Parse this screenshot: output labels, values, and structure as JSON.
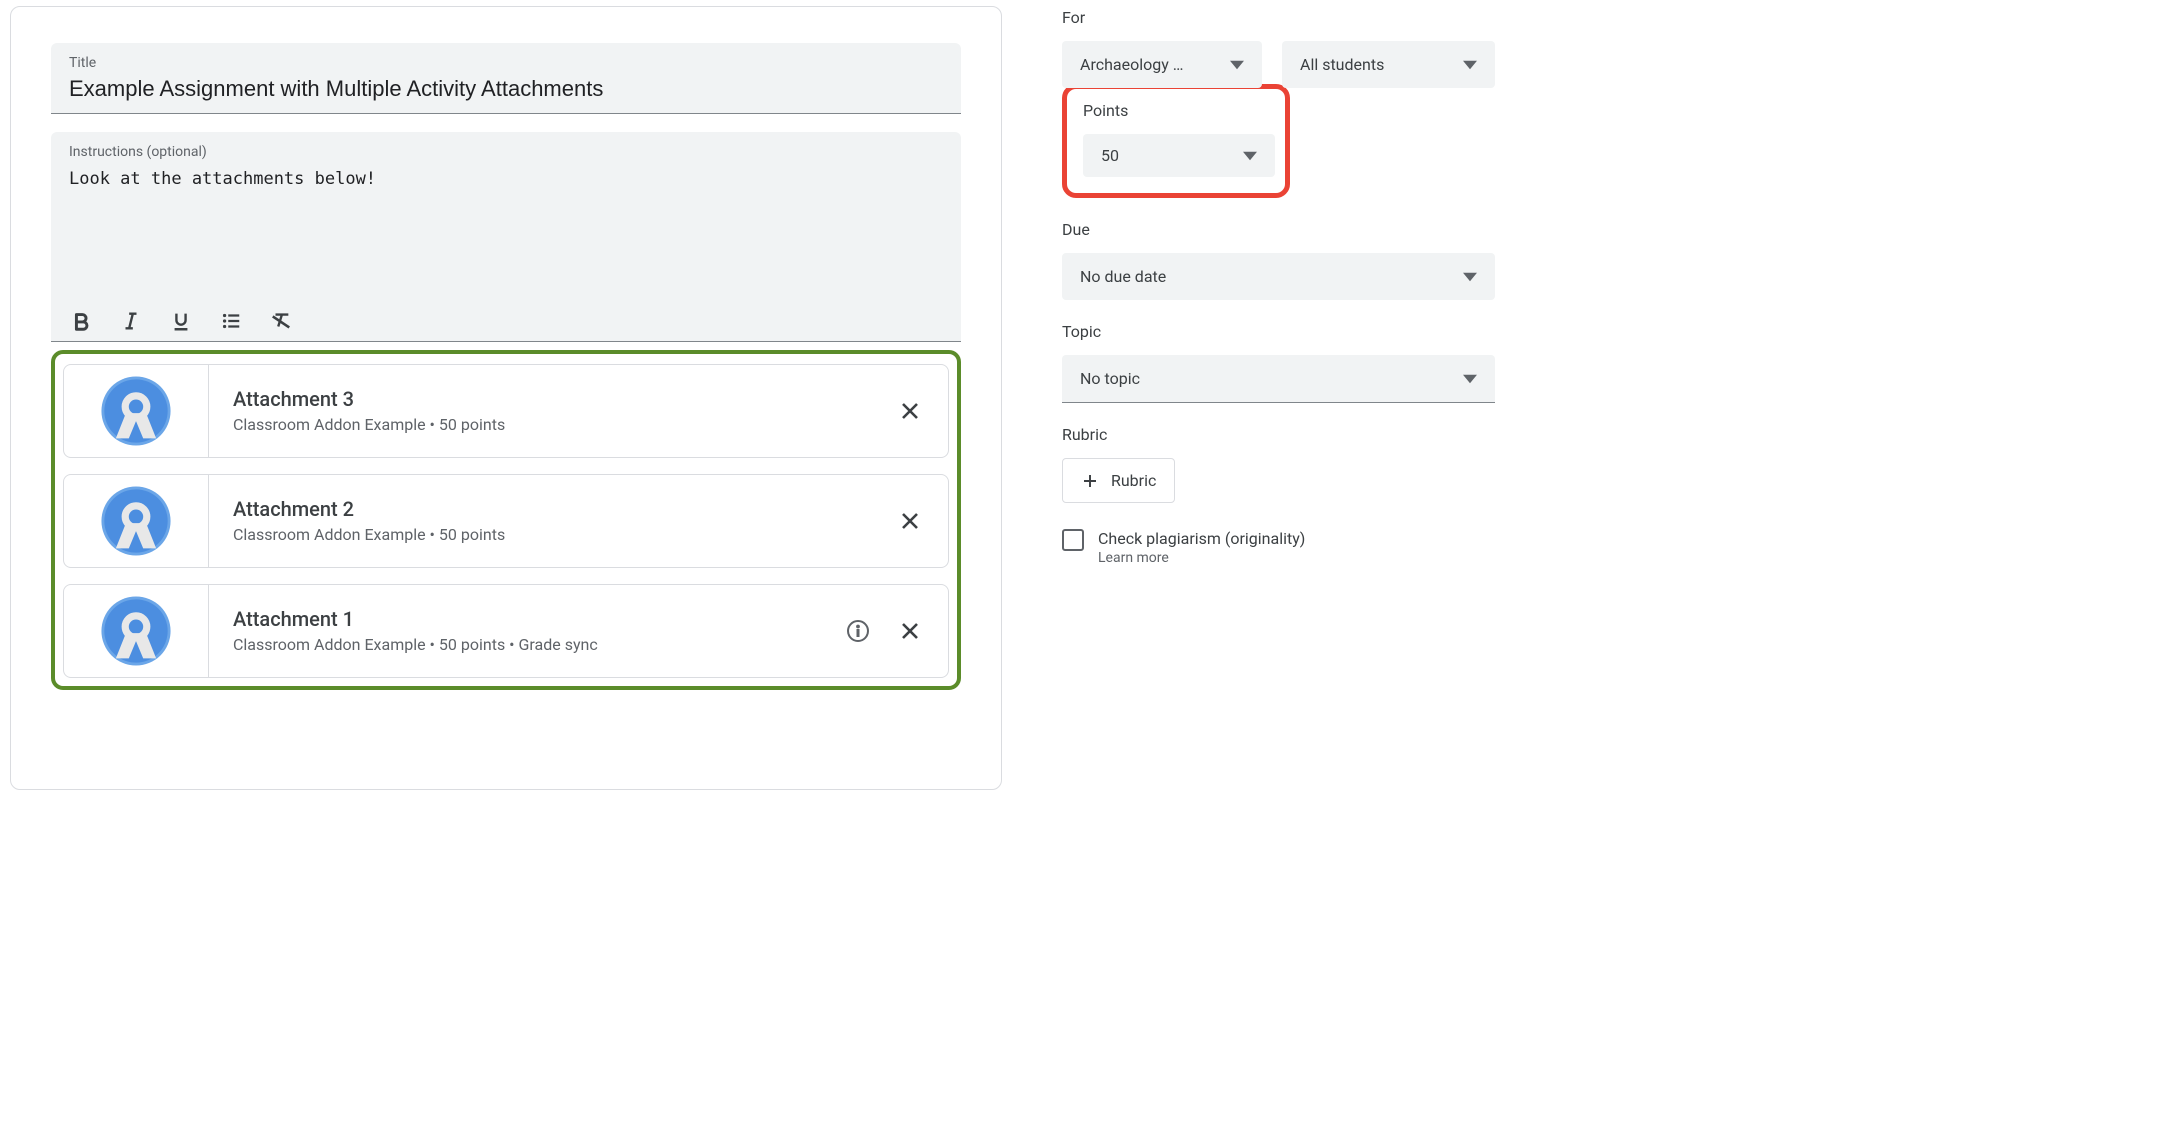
{
  "main": {
    "title_label": "Title",
    "title_value": "Example Assignment with Multiple Activity Attachments",
    "instructions_label": "Instructions (optional)",
    "instructions_value": "Look at the attachments below!"
  },
  "attachments": [
    {
      "title": "Attachment 3",
      "subtitle": "Classroom Addon Example • 50 points",
      "has_info": false
    },
    {
      "title": "Attachment 2",
      "subtitle": "Classroom Addon Example • 50 points",
      "has_info": false
    },
    {
      "title": "Attachment 1",
      "subtitle": "Classroom Addon Example • 50 points • Grade sync",
      "has_info": true
    }
  ],
  "sidebar": {
    "for_label": "For",
    "class_name": "Archaeology …",
    "students": "All students",
    "points_label": "Points",
    "points_value": "50",
    "due_label": "Due",
    "due_value": "No due date",
    "topic_label": "Topic",
    "topic_value": "No topic",
    "rubric_label": "Rubric",
    "rubric_button": "Rubric",
    "plag_label": "Check plagiarism (originality)",
    "learn_more": "Learn more"
  }
}
